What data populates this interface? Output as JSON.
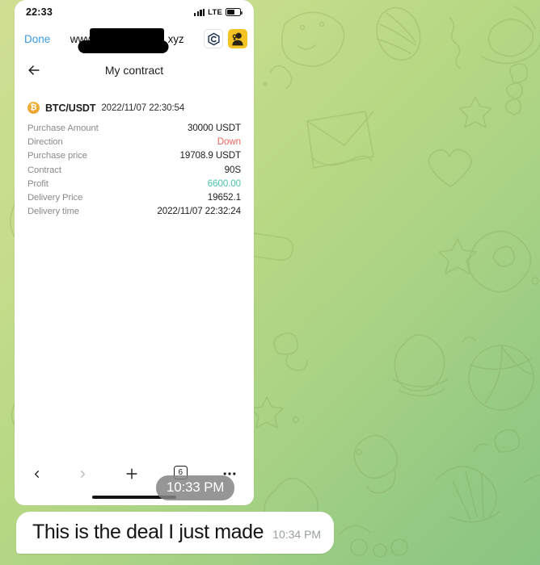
{
  "wallpaper": {
    "name": "telegram-doodle-pattern",
    "from": "#cfdf93",
    "to": "#8bc583"
  },
  "screenshot": {
    "statusbar": {
      "time": "22:33",
      "network": "LTE",
      "signal_icon": "signal-bars-icon",
      "battery_icon": "battery-icon",
      "battery_level": 62
    },
    "browserbar": {
      "done_label": "Done",
      "url_prefix": "www.",
      "url_suffix": "xyz",
      "redacted": true,
      "app_icon_1": "hexagon-c-logo-icon",
      "app_icon_1_glyph": "C",
      "app_icon_2": "user-avatar-icon"
    },
    "page": {
      "back_icon": "back-arrow-icon",
      "title": "My contract",
      "pair_icon": "bitcoin-icon",
      "pair_icon_glyph": "₿",
      "pair": "BTC/USDT",
      "order_time": "2022/11/07 22:30:54",
      "details": [
        {
          "label": "Purchase Amount",
          "value": "30000 USDT",
          "style": "normal"
        },
        {
          "label": "Direction",
          "value": "Down",
          "style": "down"
        },
        {
          "label": "Purchase price",
          "value": "19708.9 USDT",
          "style": "normal"
        },
        {
          "label": "Contract",
          "value": "90S",
          "style": "normal"
        },
        {
          "label": "Profit",
          "value": "6600.00",
          "style": "profit"
        },
        {
          "label": "Delivery Price",
          "value": "19652.1",
          "style": "normal"
        },
        {
          "label": "Delivery time",
          "value": "2022/11/07 22:32:24",
          "style": "normal"
        }
      ],
      "colors": {
        "down": "#e8675f",
        "profit": "#4ac2a8",
        "done": "#3b9ae1",
        "label": "#8a8a8f"
      }
    },
    "toolbar": {
      "back_icon": "chevron-left-icon",
      "forward_icon": "chevron-right-icon",
      "new_tab_icon": "plus-icon",
      "tab_count": "6",
      "more_icon": "ellipsis-icon",
      "home_indicator": "home-indicator"
    }
  },
  "chat": {
    "image_timestamp": "10:33 PM",
    "message_text": "This is the deal I just made",
    "message_timestamp": "10:34 PM"
  }
}
